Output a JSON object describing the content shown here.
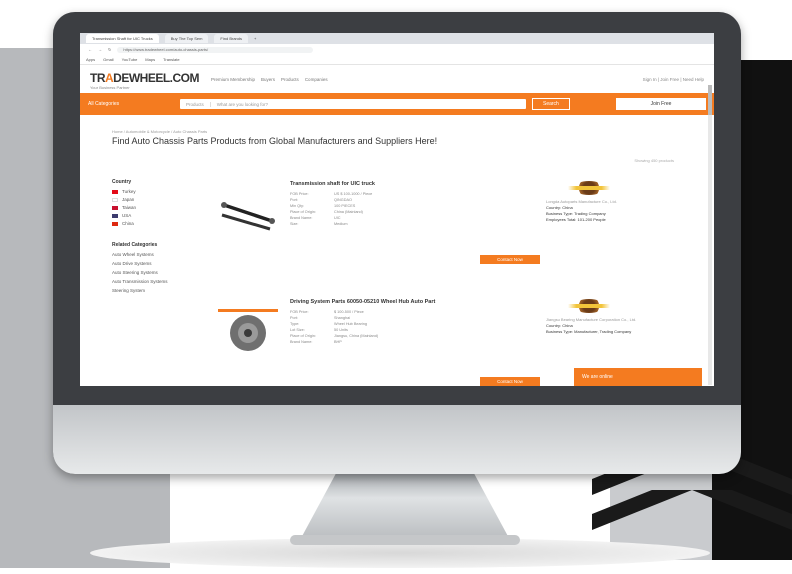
{
  "browser": {
    "tabs": [
      "Transmission Shaft for UIC Trucks",
      "Buy The Top Sem",
      "Find Brands",
      "+"
    ],
    "url": "https://www.tradewheel.com/auto-chassis-parts/",
    "bookmarks": [
      "Apps",
      "Gmail",
      "YouTube",
      "Maps",
      "Translate"
    ]
  },
  "site": {
    "logo_prefix": "TR",
    "logo_o": "A",
    "logo_rest": "DEWHEEL.COM",
    "logo_sub": "Your Business Partner",
    "nav": [
      "Premium Membership",
      "Buyers",
      "Products",
      "Companies"
    ],
    "sign": "Sign In  |  Join Free  |  Need Help",
    "all_categories": "All Categories",
    "search_category": "Products",
    "search_placeholder": "What are you looking for?",
    "search_button": "Search",
    "join_button": "Join Free"
  },
  "page": {
    "breadcrumb": "Home / Automobile & Motorcycle / Auto Chassis Parts",
    "title": "Find Auto Chassis Parts Products from Global Manufacturers and Suppliers Here!",
    "showing": "Showing 450 products"
  },
  "sidebar": {
    "country_title": "Country",
    "countries": [
      {
        "name": "Turkey",
        "color": "#e30a17"
      },
      {
        "name": "Japan",
        "color": "#bc002d"
      },
      {
        "name": "Taiwan",
        "color": "#c8102e"
      },
      {
        "name": "USA",
        "color": "#3c3b6e"
      },
      {
        "name": "China",
        "color": "#de2910"
      }
    ],
    "related_title": "Related Categories",
    "related": [
      "Auto Wheel Systems",
      "Auto Drive Systems",
      "Auto Steering Systems",
      "Auto Transmission Systems",
      "Steering System"
    ]
  },
  "products": [
    {
      "title": "Transmission shaft for UIC truck",
      "specs": [
        {
          "k": "FOB Price:",
          "v": "US $ 100-1000 / Piece"
        },
        {
          "k": "Port:",
          "v": "QINGDAO"
        },
        {
          "k": "Min Qty:",
          "v": "100 PIECES"
        },
        {
          "k": "Place of Origin:",
          "v": "China (Mainland)"
        },
        {
          "k": "Brand Name:",
          "v": "UIC"
        },
        {
          "k": "Size:",
          "v": "Medium"
        }
      ],
      "contact": "Contact Now",
      "supplier_name": "Longda Autoparts Manufacture Co., Ltd.",
      "supplier_country": "Country: China",
      "business_type": "Business Type: Trading Company",
      "employees": "Employees Total: 101-200 People"
    },
    {
      "title": "Driving System Parts 60050-05210 Wheel Hub Auto Part",
      "specs": [
        {
          "k": "FOB Price:",
          "v": "$ 100-500 / Piece"
        },
        {
          "k": "Port:",
          "v": "Shanghai"
        },
        {
          "k": "Type:",
          "v": "Wheel Hub Bearing"
        },
        {
          "k": "Lot Size:",
          "v": "50 Units"
        },
        {
          "k": "Place of Origin:",
          "v": "Jiangsu, China (Mainland)"
        },
        {
          "k": "Brand Name:",
          "v": "BHP"
        }
      ],
      "contact": "Contact Now",
      "supplier_name": "Jiangsu Bearing Manufacture Corporation Co., Ltd.",
      "supplier_country": "Country: China",
      "business_type": "Business Type: Manufacturer, Trading Company",
      "employees": ""
    }
  ],
  "chat": "We are online"
}
